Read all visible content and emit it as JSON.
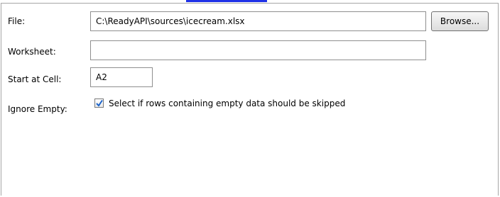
{
  "form": {
    "file": {
      "label": "File:",
      "value": "C:\\ReadyAPI\\sources\\icecream.xlsx",
      "browse_label": "Browse..."
    },
    "worksheet": {
      "label": "Worksheet:",
      "value": ""
    },
    "start_cell": {
      "label": "Start at Cell:",
      "value": "A2"
    },
    "ignore_empty": {
      "label": "Ignore Empty:",
      "checked": true,
      "text": "Select if rows containing empty data should be skipped"
    }
  },
  "colors": {
    "accent": "#1f31e6",
    "check_mark": "#1d64c9",
    "border": "#8f8f8f"
  }
}
